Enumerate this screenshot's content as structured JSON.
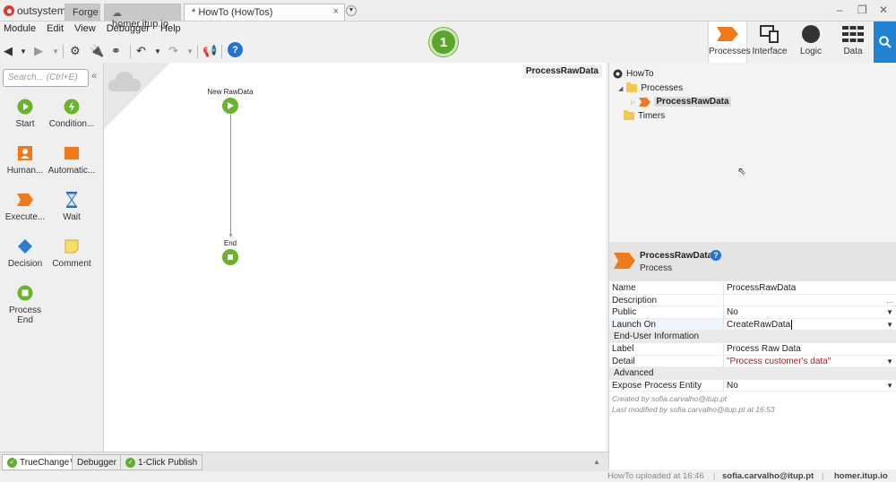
{
  "titlebar": {
    "logo_text": "outsystems",
    "tabs": [
      {
        "label": "Forge"
      },
      {
        "label": "homer.itup.io"
      },
      {
        "label": "* HowTo (HowTos)"
      }
    ],
    "close_glyph": "×"
  },
  "menu": [
    "Module",
    "Edit",
    "View",
    "Debugger",
    "Help"
  ],
  "badge": "1",
  "right_tabs": [
    {
      "label": "Processes",
      "icon": "process-icon"
    },
    {
      "label": "Interface",
      "icon": "monitor-icon"
    },
    {
      "label": "Logic",
      "icon": "logic-icon"
    },
    {
      "label": "Data",
      "icon": "grid-icon"
    }
  ],
  "palette": {
    "search_placeholder": "Search... (Ctrl+E)",
    "items": [
      {
        "label": "Start",
        "icon": "play-icon"
      },
      {
        "label": "Condition...",
        "icon": "lightning-icon"
      },
      {
        "label": "Human...",
        "icon": "person-icon"
      },
      {
        "label": "Automatic...",
        "icon": "square-icon"
      },
      {
        "label": "Execute...",
        "icon": "arrow-tag-icon"
      },
      {
        "label": "Wait",
        "icon": "hourglass-icon"
      },
      {
        "label": "Decision",
        "icon": "diamond-icon"
      },
      {
        "label": "Comment",
        "icon": "note-icon"
      },
      {
        "label": "Process End",
        "icon": "stop-icon"
      }
    ]
  },
  "canvas": {
    "title": "ProcessRawData",
    "start_label": "New RawData",
    "end_label": "End"
  },
  "tree": {
    "root": "HowTo",
    "processes": "Processes",
    "process_item": "ProcessRawData",
    "timers": "Timers"
  },
  "properties": {
    "title": "ProcessRawData",
    "subtitle": "Process",
    "rows": [
      {
        "key": "Name",
        "value": "ProcessRawData"
      },
      {
        "key": "Description",
        "value": ""
      },
      {
        "key": "Public",
        "value": "No"
      },
      {
        "key": "Launch On",
        "value": "CreateRawData"
      }
    ],
    "section_enduser": "End-User Information",
    "enduser_rows": [
      {
        "key": "Label",
        "value": "Process Raw Data"
      },
      {
        "key": "Detail",
        "value": "\"Process customer's data\""
      }
    ],
    "section_advanced": "Advanced",
    "advanced_rows": [
      {
        "key": "Expose Process Entity",
        "value": "No"
      }
    ],
    "created_by": "Created by sofia.carvalho@itup.pt",
    "modified_by": "Last modified by sofia.carvalho@itup.pt at 16:53"
  },
  "bottom_tabs": [
    {
      "label": "TrueChange™"
    },
    {
      "label": "Debugger"
    },
    {
      "label": "1-Click Publish"
    }
  ],
  "status": {
    "upload": "HowTo uploaded at 16:46",
    "user": "sofia.carvalho@itup.pt",
    "server": "homer.itup.io"
  },
  "colors": {
    "accent_blue": "#1f82d2",
    "process_orange": "#f07a1a",
    "start_green": "#67b529"
  }
}
